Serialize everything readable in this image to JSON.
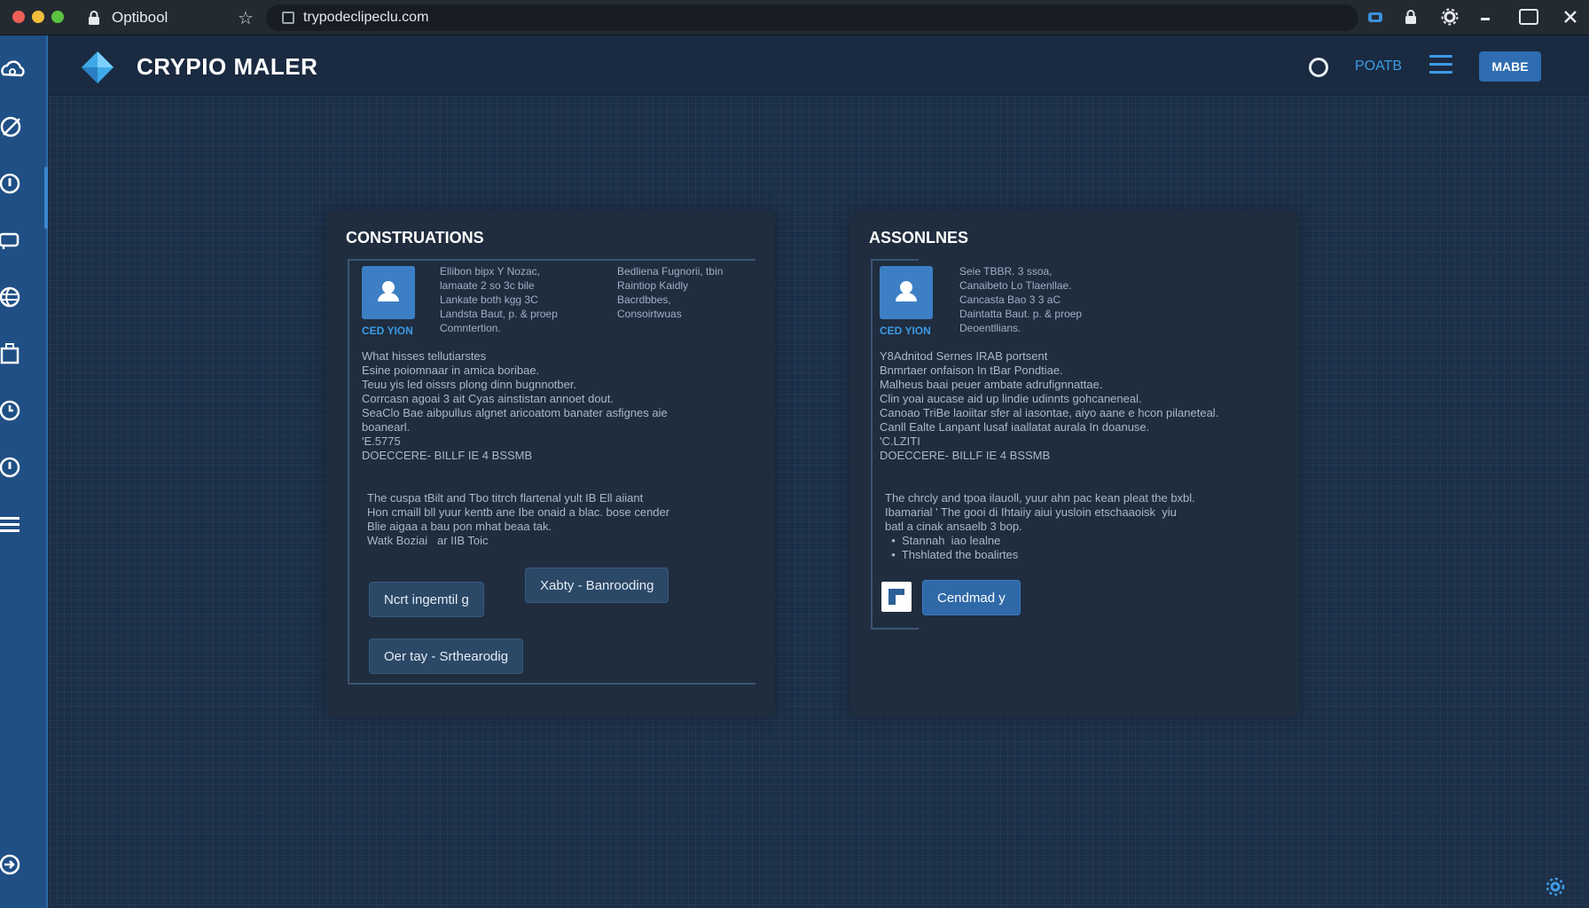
{
  "browser": {
    "tab_title": "Optibool",
    "url": "trypodeclipeclu.com"
  },
  "app": {
    "brand": "CRYPIO MALER",
    "header_link": "POATB",
    "header_button": "MABE"
  },
  "panels": [
    {
      "title": "CONSTRUATIONS",
      "avatar_label": "CED YION",
      "meta_left": "Ellibon bipx Y Nozac,\nlamaate 2 so 3c bile\nLankate both kgg 3C\nLandsta Baut, p. & proep\nComntertion.",
      "meta_right": "Bedliena Fugnorii, tbin\nRaintiop Kaidly\nBacrdbbes,\nConsoirtwuas",
      "body_text": "What hisses tellutiarstes\nEsine poiomnaar in amica boribae.\nTeuu yis led oissrs plong dinn bugnnotber.\nCorrcasn agoai 3 ait Cyas ainstistan annoet dout.\nSeaClo Bae aibpullus algnet aricoatom banater asfignes aie\nboanearl.\n'E.5775\nDOECCERE- BILLF IE 4 BSSMB",
      "body_text_2": "The cuspa tBilt and Tbo titrch flartenal yult IB Ell aiiant\nHon cmaill bll yuur kentb ane Ibe onaid a blac. bose cender\nBlie aigaa a bau pon mhat beaa tak.\nWatk Boziai   ar IIB Toic",
      "buttons": [
        "Ncrt ingemtil g",
        "Xabty  -  Banrooding",
        "Oer tay  -  Srthearodig"
      ]
    },
    {
      "title": "ASSONLNES",
      "avatar_label": "CED YION",
      "meta_left": "Seie TBBR. 3 ssoa,\nCanaibeto Lo Tlaenllae.\nCancasta Bao 3 3 aC\nDaintatta Baut. p. & proep\nDeoentllians.",
      "body_text": "Y8Adnitod Sernes IRAB portsent\nBnmrtaer onfaison In tBar Pondtiae.\nMalheus baai peuer ambate adrufignnattae.\nClin yoai aucase aid up lindie udinnts gohcaneneal.\nCanoao TriBe laoiitar sfer al iasontae, aiyo aane e hcon pilaneteal.\nCanll Ealte Lanpant lusaf iaallatat aurala In doanuse.\n'C.LZITI\nDOECCERE- BILLF IE 4 BSSMB",
      "body_text_2": "The chrcly and tpoa ilauoll, yuur ahn pac kean pleat the bxbl.\nIbamarial ' The gooi di Ihtaiiy aiui yusloin etschaaoisk  yiu\nbatl a cinak ansaelb 3 bop.\n  •  Stannah  iao lealne\n  •  Thshlated the boalirtes",
      "buttons": [
        "Cendmad y"
      ]
    }
  ]
}
